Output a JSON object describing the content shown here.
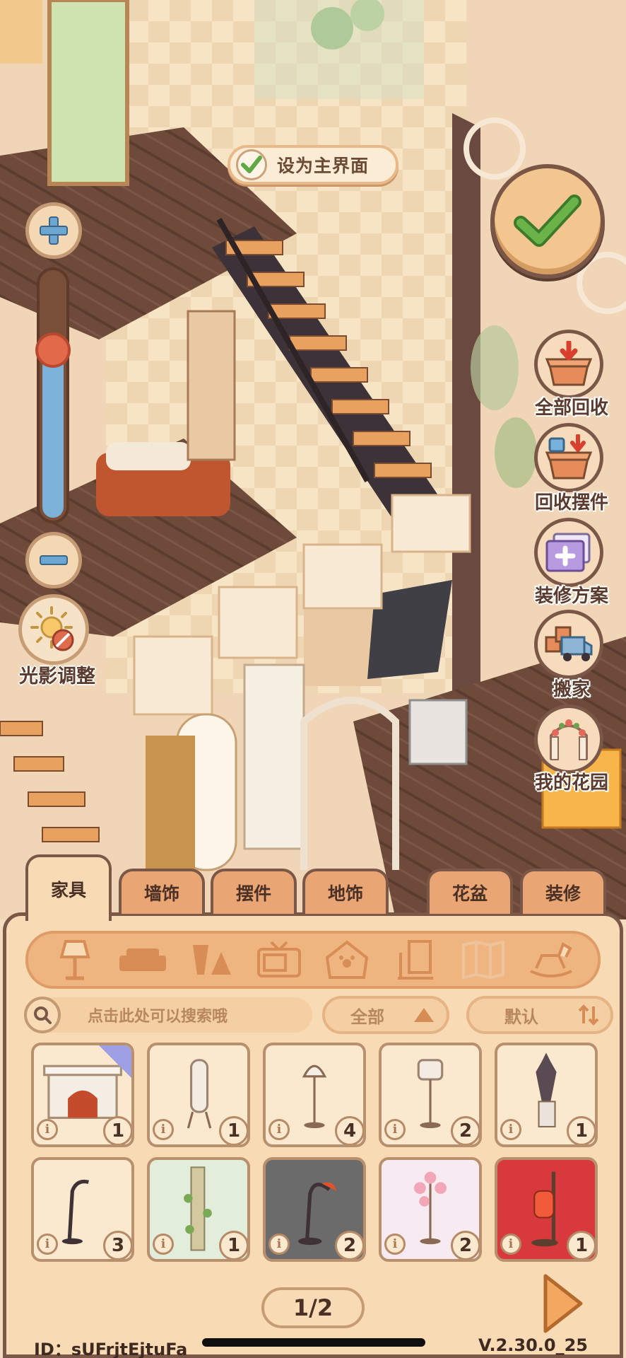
{
  "top": {
    "set_main_label": "设为主界面"
  },
  "zoom": {
    "level": 0.32
  },
  "left": {
    "light_label": "光影调整"
  },
  "side": [
    {
      "label": "全部回收",
      "icon": "recycle-all-icon"
    },
    {
      "label": "回收摆件",
      "icon": "recycle-ornament-icon"
    },
    {
      "label": "装修方案",
      "icon": "decoration-plan-icon"
    },
    {
      "label": "搬家",
      "icon": "moving-truck-icon"
    },
    {
      "label": "我的花园",
      "icon": "garden-arch-icon"
    }
  ],
  "tabs": [
    "家具",
    "墙饰",
    "摆件",
    "地饰",
    "花盆",
    "装修"
  ],
  "active_tab": "家具",
  "categories": [
    "lamp",
    "sofa",
    "table",
    "tv",
    "pet-house",
    "shelf",
    "screen",
    "rocking-horse"
  ],
  "search": {
    "placeholder": "点击此处可以搜索哦"
  },
  "filter": {
    "all": "全部",
    "sort": "默认"
  },
  "items": [
    {
      "name": "fireplace",
      "count": "1",
      "tag": true
    },
    {
      "name": "column-floor-lamp",
      "count": "1"
    },
    {
      "name": "tassel-floor-lamp",
      "count": "4"
    },
    {
      "name": "drum-floor-lamp",
      "count": "2"
    },
    {
      "name": "cat-statue-lamp",
      "count": "1"
    },
    {
      "name": "arc-floor-lamp",
      "count": "3"
    },
    {
      "name": "vine-bamboo-lamp",
      "count": "1"
    },
    {
      "name": "red-shade-lamp",
      "count": "2"
    },
    {
      "name": "flower-bell-lamp",
      "count": "2"
    },
    {
      "name": "red-lantern-lamp",
      "count": "1"
    }
  ],
  "pager": "1/2",
  "footer": {
    "id": "ID：sUFrjtEjtuFa",
    "version": "V.2.30.0_25"
  },
  "colors": {
    "panel": "#f8dbb5",
    "border": "#7b5748",
    "tab": "#e9a574",
    "accent_green": "#5fa843"
  }
}
